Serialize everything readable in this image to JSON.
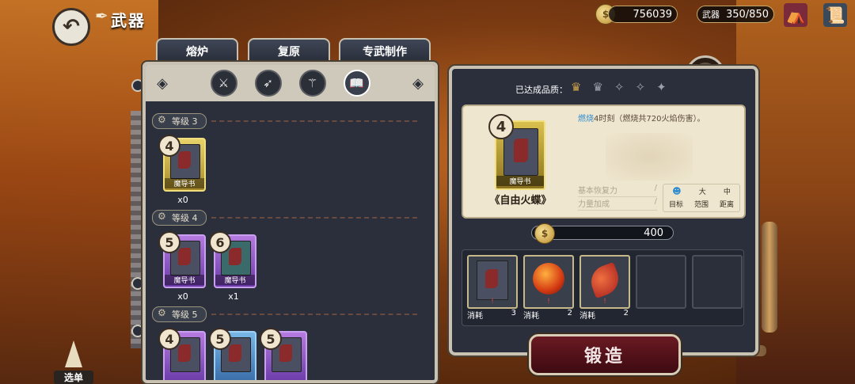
{
  "header": {
    "title": "武器",
    "gold": "756039",
    "weapon_label": "武器",
    "weapon_count": "350/850"
  },
  "tabs": [
    "熔炉",
    "复原",
    "专武制作"
  ],
  "filters": [
    "filter-sword",
    "filter-bow",
    "filter-staff",
    "filter-book"
  ],
  "levels": [
    {
      "label": "等级 3",
      "cards": [
        {
          "rank": "4",
          "color": "gold",
          "tag": "魔导书",
          "qty": "x0"
        }
      ]
    },
    {
      "label": "等级 4",
      "cards": [
        {
          "rank": "5",
          "color": "purple",
          "tag": "魔导书",
          "qty": "x0"
        },
        {
          "rank": "6",
          "color": "purple",
          "tag": "魔导书",
          "qty": "x1"
        }
      ]
    },
    {
      "label": "等级 5",
      "cards": [
        {
          "rank": "4",
          "color": "purple"
        },
        {
          "rank": "5",
          "color": "blue"
        },
        {
          "rank": "5",
          "color": "purple"
        }
      ]
    }
  ],
  "detail": {
    "quality_label": "已达成品质：",
    "quality_icons": [
      "crown-icon",
      "crown-icon",
      "diamond-icon",
      "diamond-icon",
      "diamond-icon"
    ],
    "rank": "4",
    "card_tag": "魔导书",
    "name": "《自由火蝶》",
    "desc_keyword": "燃烧",
    "desc_text": "4时刻（燃烧共720火焰伤害）。",
    "stat1_label": "基本恢复力",
    "stat2_label": "力量加成",
    "stat_sep": "/",
    "target_big": "大",
    "target_mid": "中",
    "target_label": "目标",
    "range_label": "范围",
    "distance_label": "距离",
    "cost": "400"
  },
  "materials": [
    {
      "type": "book",
      "label": "消耗",
      "count": "3"
    },
    {
      "type": "orb",
      "label": "消耗",
      "count": "2"
    },
    {
      "type": "feather",
      "label": "消耗",
      "count": "2"
    },
    {
      "type": "empty"
    },
    {
      "type": "empty"
    }
  ],
  "forge_label": "锻造",
  "select_label": "选单"
}
